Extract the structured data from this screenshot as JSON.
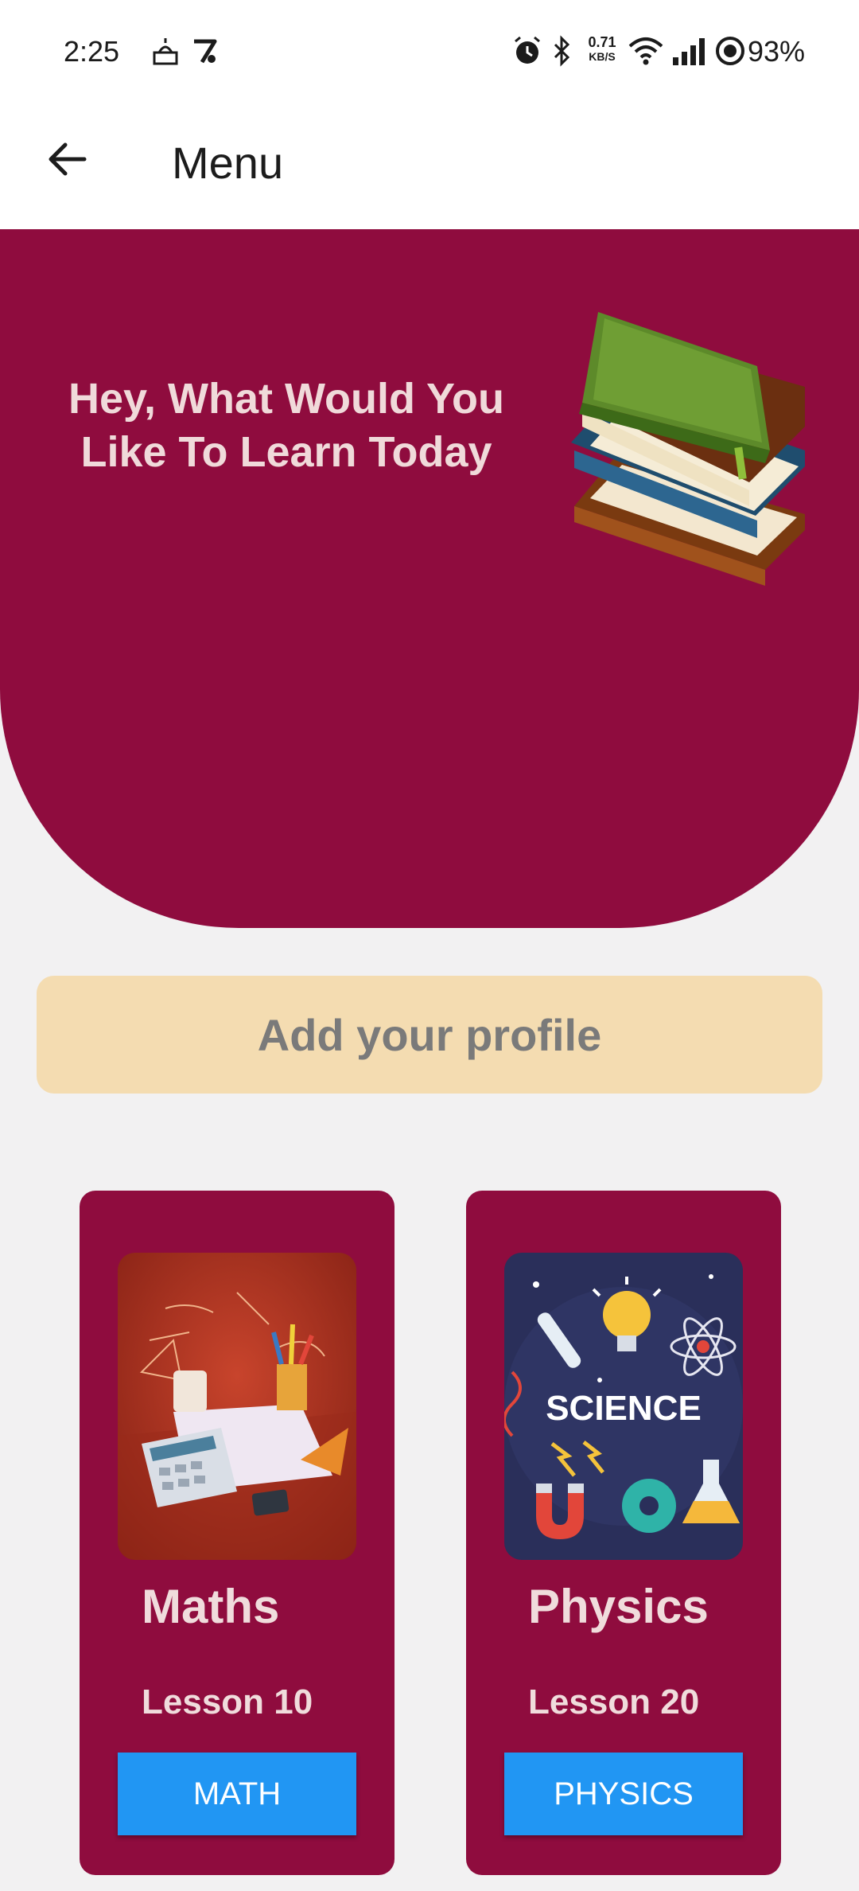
{
  "status_bar": {
    "time": "2:25",
    "net_speed_value": "0.71",
    "net_speed_unit": "KB/S",
    "battery": "93%"
  },
  "app_bar": {
    "title": "Menu"
  },
  "hero": {
    "greeting": "Hey, What Would You Like To Learn Today"
  },
  "profile": {
    "label": "Add your profile"
  },
  "subjects": [
    {
      "title": "Maths",
      "lesson": "Lesson 10",
      "button": "MATH"
    },
    {
      "title": "Physics",
      "lesson": "Lesson 20",
      "button": "PHYSICS",
      "image_text": "SCIENCE"
    }
  ],
  "colors": {
    "primary": "#8f0c3e",
    "profile_bg": "#f4dcb1",
    "button_blue": "#2196f3",
    "background": "#f2f1f2"
  }
}
